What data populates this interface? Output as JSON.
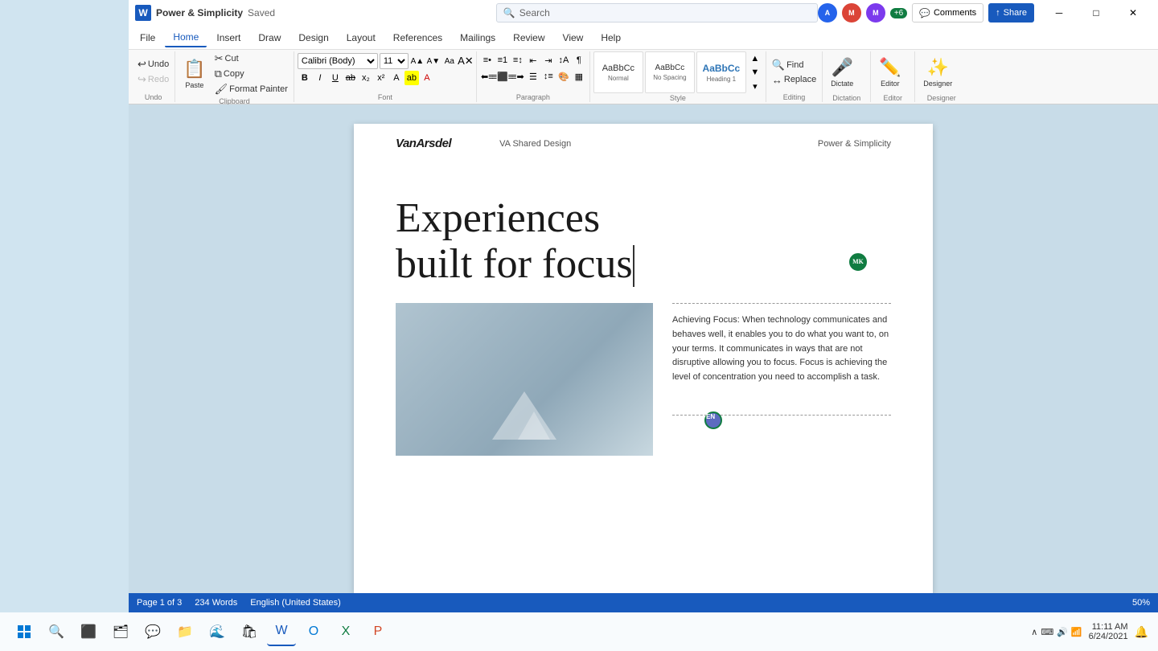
{
  "window": {
    "title": "Power & Simplicity",
    "saved_label": "Saved",
    "icon_label": "W"
  },
  "search": {
    "placeholder": "Search"
  },
  "title_bar": {
    "minimize": "─",
    "maximize": "□",
    "close": "✕",
    "comments_label": "Comments",
    "share_label": "Share",
    "collaborators_extra": "+6"
  },
  "ribbon": {
    "tabs": [
      "File",
      "Home",
      "Insert",
      "Draw",
      "Design",
      "Layout",
      "References",
      "Mailings",
      "Review",
      "View",
      "Help"
    ],
    "active_tab": "Home",
    "groups": {
      "undo": {
        "label": "Undo",
        "undo_label": "Undo",
        "redo_label": "Redo"
      },
      "clipboard": {
        "label": "Clipboard",
        "paste_label": "Paste",
        "cut_label": "Cut",
        "copy_label": "Copy",
        "format_painter_label": "Format Painter"
      },
      "font": {
        "label": "Font",
        "font_name": "Calibri (Body)",
        "font_size": "11",
        "bold": "B",
        "italic": "I",
        "underline": "U",
        "strikethrough": "S",
        "subscript": "x₂",
        "superscript": "x²"
      },
      "paragraph": {
        "label": "Paragraph"
      },
      "style": {
        "label": "Style",
        "items": [
          {
            "name": "Normal",
            "label": "AaBbCc"
          },
          {
            "name": "No Spacing",
            "label": "AaBbCc"
          },
          {
            "name": "Heading 1",
            "label": "AaBbCc"
          }
        ]
      },
      "editing": {
        "label": "Editing",
        "find_label": "Find",
        "replace_label": "Replace"
      },
      "dictation": {
        "label": "Dictation",
        "dictate_label": "Dictate"
      },
      "editor": {
        "label": "Editor",
        "editor_label": "Editor"
      },
      "designer": {
        "label": "Designer",
        "designer_label": "Designer"
      }
    }
  },
  "document": {
    "header": {
      "logo": "VanArsdel",
      "subtitle": "VA Shared Design",
      "doc_title": "Power & Simplicity"
    },
    "title": "Experiences built for focus",
    "body_text": "Achieving Focus: When technology communicates and behaves well, it enables you to do what you want to, on your terms. It communicates in ways that are not disruptive allowing you to focus. Focus is achieving the level of concentration you need to accomplish a task.",
    "collaborators": {
      "mk_initials": "MK",
      "en_initials": "EN"
    }
  },
  "status_bar": {
    "page_info": "Page 1 of 3",
    "word_count": "234 Words",
    "language": "English (United States)",
    "zoom": "50%"
  },
  "taskbar": {
    "time": "11:11 AM",
    "date": "6/24/2021"
  }
}
